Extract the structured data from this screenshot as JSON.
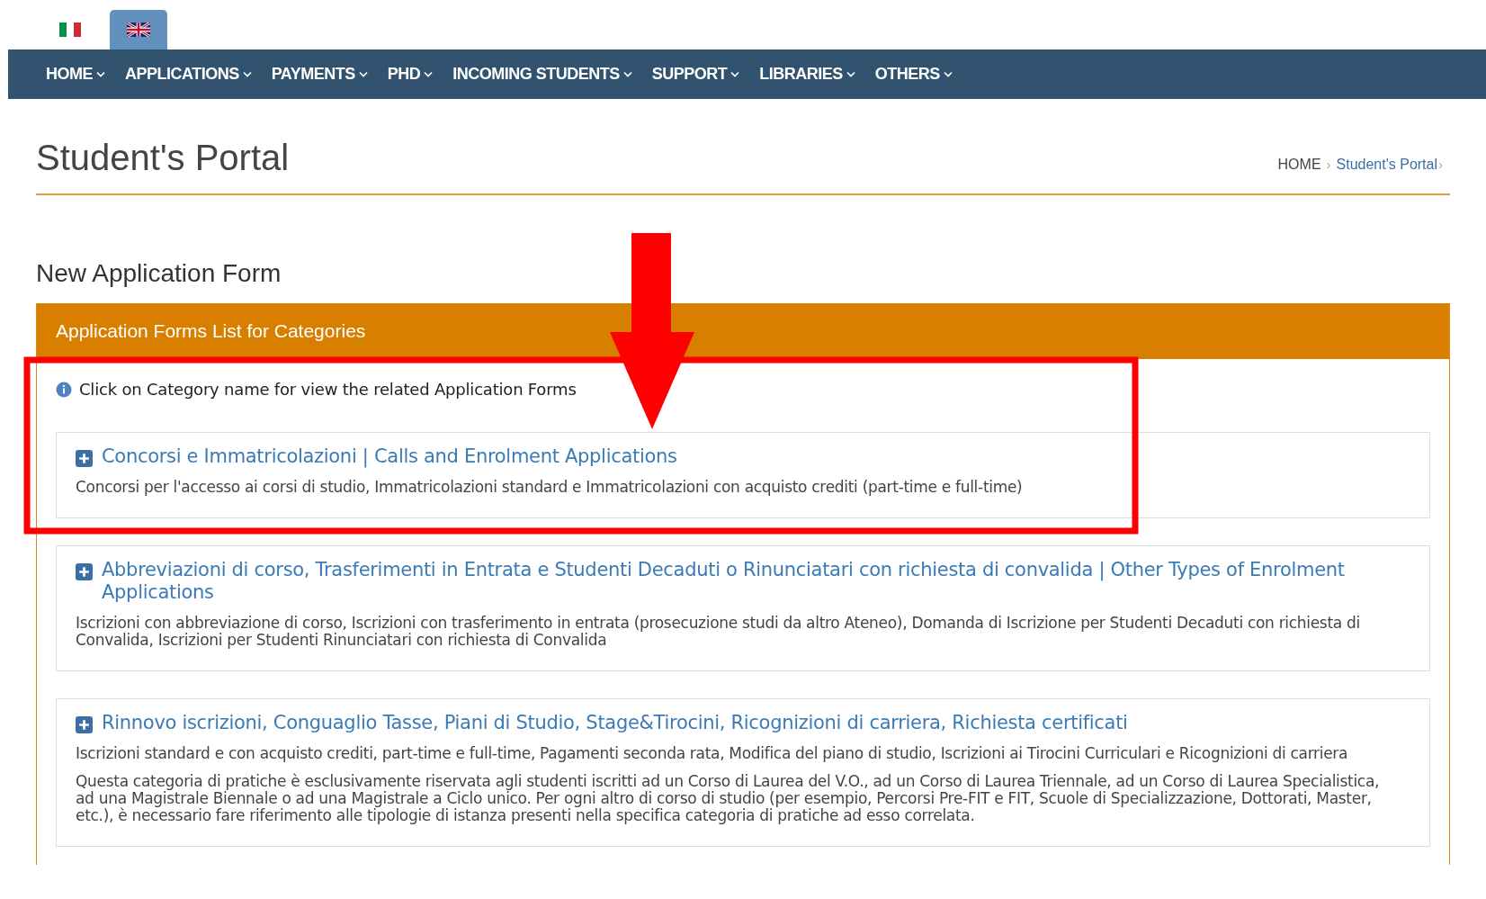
{
  "languages": [
    {
      "kind": "italian",
      "selected": false
    },
    {
      "kind": "english",
      "selected": true
    }
  ],
  "nav": [
    "HOME",
    "APPLICATIONS",
    "PAYMENTS",
    "PHD",
    "INCOMING STUDENTS",
    "SUPPORT",
    "LIBRARIES",
    "OTHERS"
  ],
  "page_title": "Student's Portal",
  "breadcrumb": [
    {
      "label": "HOME",
      "separator": "›"
    },
    {
      "label": "Student's Portal",
      "separator": "›"
    }
  ],
  "section_title": "New Application Form",
  "panel": {
    "title": "Application Forms List for Categories",
    "hint": "Click on Category name for view the related Application Forms",
    "categories": [
      {
        "title": "Concorsi e Immatricolazioni | Calls and Enrolment Applications",
        "paragraphs": [
          "Concorsi per l'accesso ai corsi di studio, Immatricolazioni standard e Immatricolazioni con acquisto crediti (part-time e full-time)"
        ]
      },
      {
        "title": "Abbreviazioni di corso, Trasferimenti in Entrata e Studenti Decaduti o Rinunciatari con richiesta di convalida | Other Types of Enrolment Applications",
        "paragraphs": [
          "Iscrizioni con abbreviazione di corso, Iscrizioni con trasferimento in entrata (prosecuzione studi da altro Ateneo), Domanda di Iscrizione per Studenti Decaduti con richiesta di Convalida, Iscrizioni per Studenti Rinunciatari con richiesta di Convalida"
        ]
      },
      {
        "title": "Rinnovo iscrizioni, Conguaglio Tasse, Piani di Studio, Stage&Tirocini, Ricognizioni di carriera, Richiesta certificati",
        "paragraphs": [
          "Iscrizioni standard e con acquisto crediti, part-time e full-time, Pagamenti seconda rata, Modifica del piano di studio, Iscrizioni ai Tirocini Curriculari e Ricognizioni di carriera",
          "Questa categoria di pratiche è esclusivamente riservata agli studenti iscritti ad un Corso di Laurea del V.O., ad un Corso di Laurea Triennale, ad un Corso di Laurea Specialistica, ad una Magistrale Biennale o ad una Magistrale a Ciclo unico. Per ogni altro di corso di studio (per esempio, Percorsi Pre-FIT e FIT, Scuole di Specializzazione, Dottorati, Master, etc.), è necessario fare riferimento alle tipologie di istanza presenti nella specifica categoria di pratiche ad esso correlata."
        ]
      }
    ]
  }
}
